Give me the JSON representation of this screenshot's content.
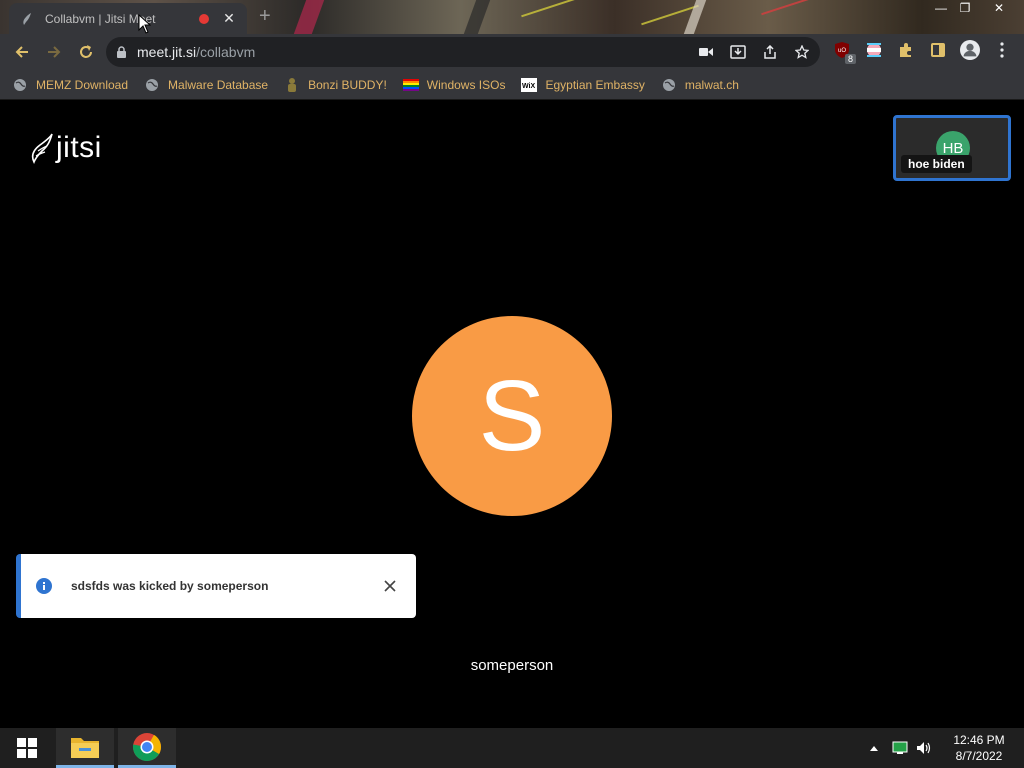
{
  "window": {
    "minimize": "—",
    "restore": "❐",
    "close": "✕"
  },
  "tab": {
    "title": "Collabvm | Jitsi Meet",
    "close": "✕",
    "new_tab": "+"
  },
  "address_bar": {
    "host": "meet.jit.si",
    "path": "/collabvm"
  },
  "extensions": {
    "ublock_badge": "8"
  },
  "bookmarks": [
    {
      "label": "MEMZ Download",
      "icon": "globe-icon"
    },
    {
      "label": "Malware Database",
      "icon": "globe-icon"
    },
    {
      "label": "Bonzi BUDDY!",
      "icon": "bonzi-icon"
    },
    {
      "label": "Windows ISOs",
      "icon": "rainbow-flag-icon"
    },
    {
      "label": "Egyptian Embassy",
      "icon": "wix-icon"
    },
    {
      "label": "malwat.ch",
      "icon": "globe-icon"
    }
  ],
  "meeting": {
    "logo_text": "jitsi",
    "thumbnail": {
      "initials": "HB",
      "name": "hoe biden",
      "avatar_color": "#3aa36b"
    },
    "dominant": {
      "initial": "S",
      "name": "someperson",
      "avatar_color": "#f99b45"
    },
    "notification": {
      "message": "sdsfds was kicked by someperson"
    }
  },
  "taskbar": {
    "time": "12:46 PM",
    "date": "8/7/2022"
  },
  "colors": {
    "accent_blue": "#2f74d0",
    "bookmark_text": "#e0b366"
  }
}
